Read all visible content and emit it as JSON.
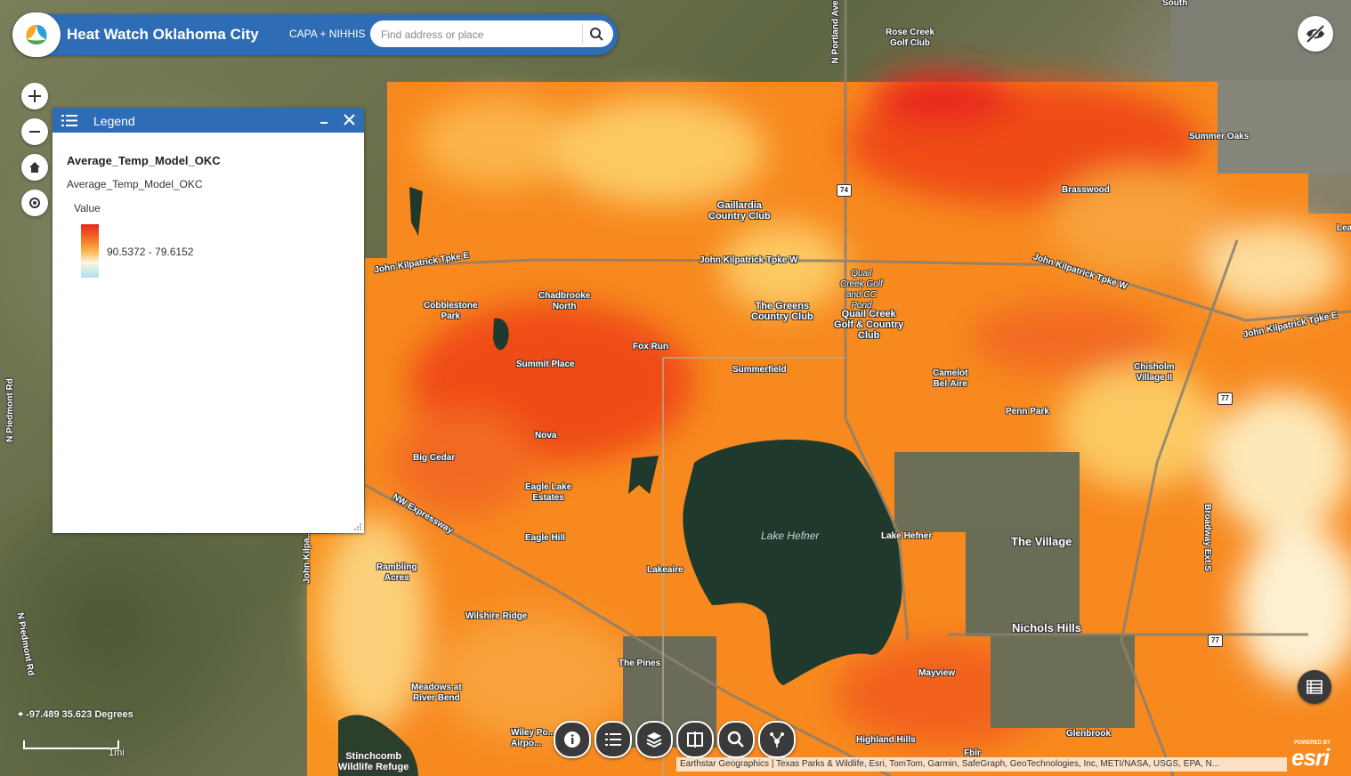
{
  "header": {
    "title": "Heat Watch Oklahoma City",
    "subtitle": "CAPA + NIHHIS",
    "search_placeholder": "Find address or place"
  },
  "legend": {
    "title": "Legend",
    "layer_title": "Average_Temp_Model_OKC",
    "layer_sub": "Average_Temp_Model_OKC",
    "field": "Value",
    "range_label": "90.5372 - 79.6152",
    "ramp_colors": [
      "#e8261c",
      "#f36a20",
      "#fbb54a",
      "#fdf6e0",
      "#a9dff3"
    ]
  },
  "map": {
    "coordinates": "-97.489 35.623 Degrees",
    "scale_label": "1mi",
    "attribution": "Earthstar Geographics | Texas Parks & Wildlife, Esri, TomTom, Garmin, SafeGraph, GeoTechnologies, Inc, METI/NASA, USGS, EPA, N...",
    "powered_by": "POWERED BY",
    "esri_logo": "esri",
    "labels": {
      "south": "South",
      "portland": "N Portland Ave",
      "rose_creek": "Rose Creek\nGolf Club",
      "summer_oaks": "Summer Oaks",
      "brasswood": "Brasswood",
      "leg": "Lea",
      "gaillardia": "Gaillardia\nCountry Club",
      "kilpatrick_e": "John Kilpatrick Tpke E",
      "kilpatrick_w": "John Kilpatrick Tpke W",
      "kilpatrick_w2": "John Kilpatrick Tpke W",
      "kilpatrick_e2": "John Kilpatrick Tpke E",
      "quail_creek_golf": "Quail\nCreek Golf\nand CC\nPond",
      "quail_creek_cc": "Quail Creek\nGolf & Country\nClub",
      "cobblestone": "Cobblestone\nPark",
      "chadbrooke": "Chadbrooke\nNorth",
      "greens": "The Greens\nCountry Club",
      "fox_run": "Fox Run",
      "summit_place": "Summit Place",
      "summerfield": "Summerfield",
      "camelot": "Camelot\nBel-Aire",
      "chisholm": "Chisholm\nVillage II",
      "penn_park": "Penn Park",
      "nova": "Nova",
      "big_cedar": "Big Cedar",
      "eagle_lake": "Eagle Lake\nEstates",
      "nw_expressway": "NW Expressway",
      "eagle_hill": "Eagle Hill",
      "lake_hefner": "Lake Hefner",
      "lake_hefner_small": "Lake Hefner",
      "the_village": "The Village",
      "broadway": "Broadway Ext S",
      "rambling": "Rambling\nAcres",
      "lakeaire": "Lakeaire",
      "wilshire": "Wilshire Ridge",
      "nichols_hills": "Nichols Hills",
      "the_pines": "The Pines",
      "mayview": "Mayview",
      "meadows": "Meadows at\nRiver Bend",
      "wiley_post": "Wiley Po...\nAirpo...",
      "highland_hills": "Highland Hills",
      "glenbrook": "Glenbrook",
      "stinchcomb": "Stinchcomb\nWildlife Refuge",
      "piedmont1": "N Piedmont Rd",
      "piedmont2": "N Piedmont Rd",
      "kilpatrick_n": "John Kilpa...",
      "fblr": "Fblr",
      "hwy74": "74",
      "hwy77a": "77",
      "hwy77b": "77"
    }
  },
  "colors": {
    "header_blue": "#2e6db5",
    "tool_dark": "#3a3a3a"
  }
}
